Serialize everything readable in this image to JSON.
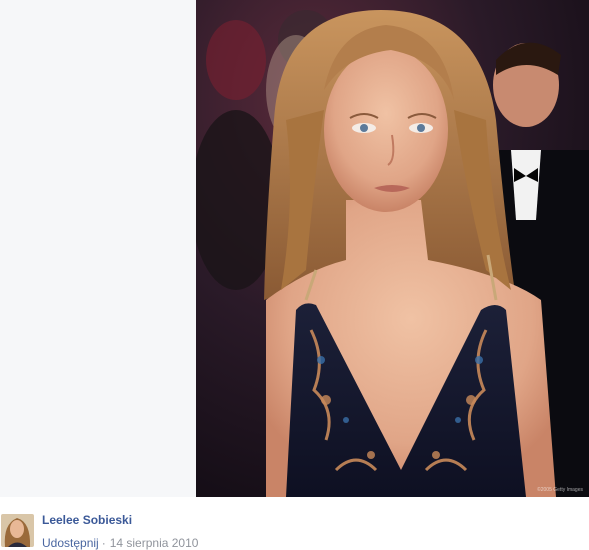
{
  "photo": {
    "subject": "portrait-photo",
    "watermark": "©2005 Getty Images"
  },
  "post": {
    "author": "Leelee Sobieski",
    "share_label": "Udostępnij",
    "separator": "·",
    "date": "14 sierpnia 2010"
  },
  "colors": {
    "link": "#3b5998",
    "meta": "#90949c",
    "margin_bg": "#f6f7f9"
  }
}
